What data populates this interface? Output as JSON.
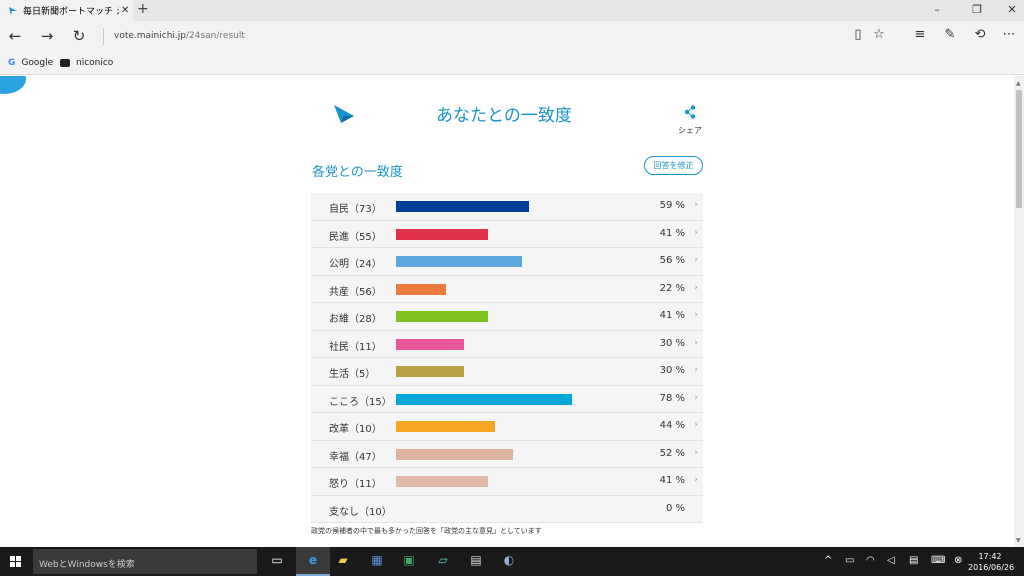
{
  "browser": {
    "tab_title": "毎日新聞ボートマッチ えら",
    "tab_close": "✕",
    "new_tab": "+",
    "url_domain": "vote.mainichi.jp",
    "url_path": "/24san/result",
    "favorites": [
      {
        "label": "Google",
        "icon": "google-icon"
      },
      {
        "label": "niconico",
        "icon": "niconico-icon"
      }
    ]
  },
  "page": {
    "heading": "あなたとの一致度",
    "share_label": "シェア",
    "subheading": "各党との一致度",
    "edit_button": "回答を修正",
    "note": "政党の候補者の中で最も多かった回答を「政党の主な意見」としています"
  },
  "results": [
    {
      "party": "自民（73）",
      "percent": 59,
      "label": "59 %",
      "color": "#003f98"
    },
    {
      "party": "民進（55）",
      "percent": 41,
      "label": "41 %",
      "color": "#e0304a"
    },
    {
      "party": "公明（24）",
      "percent": 56,
      "label": "56 %",
      "color": "#5ea8e0"
    },
    {
      "party": "共産（56）",
      "percent": 22,
      "label": "22 %",
      "color": "#ec7a3c"
    },
    {
      "party": "お維（28）",
      "percent": 41,
      "label": "41 %",
      "color": "#7dc21e"
    },
    {
      "party": "社民（11）",
      "percent": 30,
      "label": "30 %",
      "color": "#e8579a"
    },
    {
      "party": "生活（5）",
      "percent": 30,
      "label": "30 %",
      "color": "#b9a045"
    },
    {
      "party": "こころ（15）",
      "percent": 78,
      "label": "78 %",
      "color": "#00a7d8"
    },
    {
      "party": "改革（10）",
      "percent": 44,
      "label": "44 %",
      "color": "#f5a623"
    },
    {
      "party": "幸福（47）",
      "percent": 52,
      "label": "52 %",
      "color": "#ddb3a0"
    },
    {
      "party": "怒り（11）",
      "percent": 41,
      "label": "41 %",
      "color": "#e0b8a8"
    },
    {
      "party": "支なし（10）",
      "percent": 0,
      "label": "0 %",
      "color": "#cccccc"
    }
  ],
  "taskbar": {
    "search_placeholder": "WebとWindowsを検索",
    "time": "17:42",
    "date": "2016/06/26"
  }
}
